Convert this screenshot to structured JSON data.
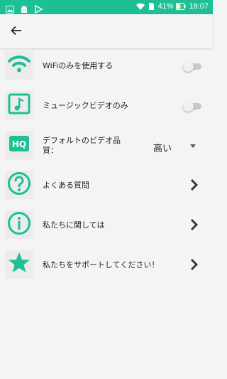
{
  "status_bar": {
    "battery_percent": "41%",
    "time": "18:07",
    "icons": [
      "image-icon",
      "android-icon",
      "play-store-icon",
      "wifi-icon",
      "sim-icon",
      "battery-charging-icon"
    ]
  },
  "app_bar": {
    "back_icon": "arrow-left-icon"
  },
  "settings": {
    "wifi_only": {
      "label": "WiFiのみを使用する",
      "icon": "wifi-icon",
      "enabled": false
    },
    "music_video_only": {
      "label": "ミュージックビデオのみ",
      "icon": "music-note-icon",
      "enabled": false
    },
    "default_quality": {
      "label": "デフォルトのビデオ品質：",
      "icon": "hq-icon",
      "value": "高い"
    },
    "faq": {
      "label": "よくある質問",
      "icon": "question-circle-icon"
    },
    "about": {
      "label": "私たちに関しては",
      "icon": "info-circle-icon"
    },
    "support": {
      "label": "私たちをサポートしてください！",
      "icon": "star-icon"
    }
  },
  "colors": {
    "accent": "#1fbf96",
    "status_bar": "#1fbf96",
    "background": "#f4f4f4",
    "tile": "#ececec"
  }
}
